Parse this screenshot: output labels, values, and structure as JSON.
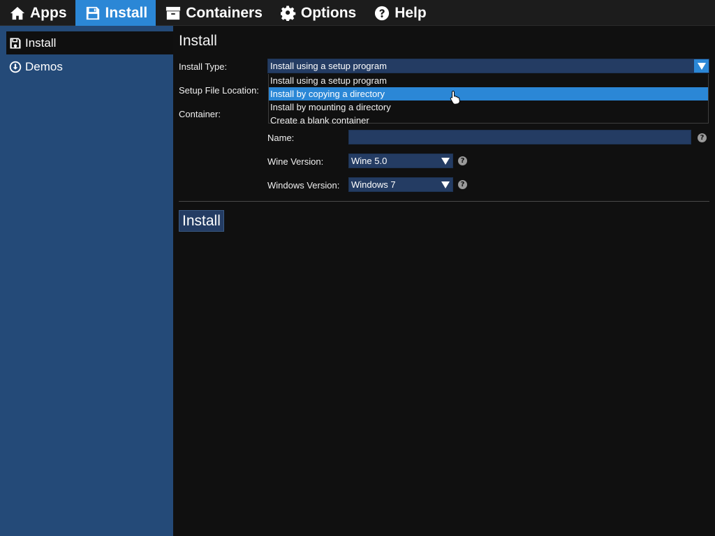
{
  "topnav": {
    "items": [
      {
        "label": "Apps",
        "icon": "home-icon"
      },
      {
        "label": "Install",
        "icon": "floppy-disk-icon",
        "active": true
      },
      {
        "label": "Containers",
        "icon": "archive-box-icon"
      },
      {
        "label": "Options",
        "icon": "gear-icon"
      },
      {
        "label": "Help",
        "icon": "question-circle-icon"
      }
    ]
  },
  "sidebar": {
    "items": [
      {
        "label": "Install",
        "icon": "floppy-disk-icon",
        "active": true
      },
      {
        "label": "Demos",
        "icon": "download-circle-icon"
      }
    ]
  },
  "main": {
    "title": "Install",
    "install_type": {
      "label": "Install Type:",
      "value": "Install using a setup program",
      "options": [
        "Install using a setup program",
        "Install by copying a directory",
        "Install by mounting a directory",
        "Create a blank container"
      ],
      "highlighted_index": 1
    },
    "setup_file_location": {
      "label": "Setup File Location:"
    },
    "container": {
      "label": "Container:"
    },
    "name": {
      "label": "Name:",
      "value": ""
    },
    "wine_version": {
      "label": "Wine Version:",
      "value": "Wine 5.0"
    },
    "windows_version": {
      "label": "Windows Version:",
      "value": "Windows 7"
    },
    "help_glyph": "?",
    "install_button": "Install"
  },
  "colors": {
    "accent": "#2b87d6",
    "sidebar": "#244a78",
    "field": "#243c63",
    "background": "#101010"
  }
}
